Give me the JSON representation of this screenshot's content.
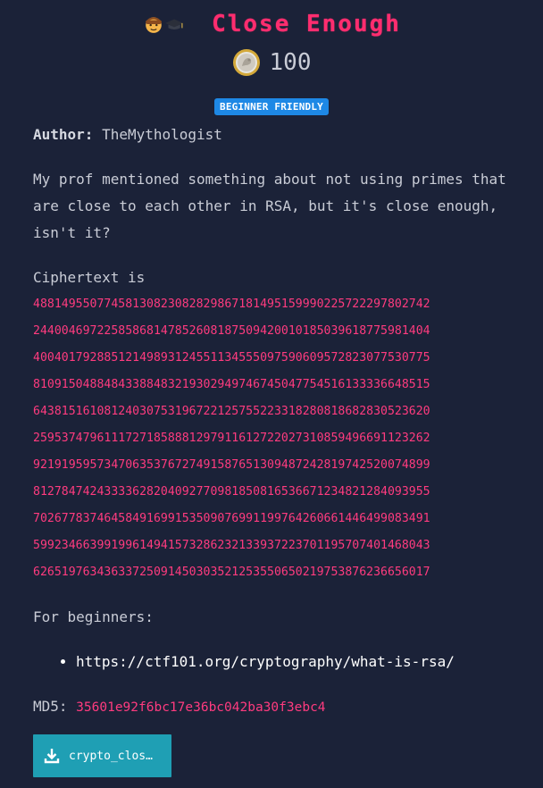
{
  "challenge": {
    "title": "Close Enough",
    "points": "100",
    "badge": "BEGINNER FRIENDLY",
    "author_label": "Author:",
    "author": "TheMythologist",
    "description": "My prof mentioned something about not using primes that are close to each other in RSA, but it's close enough, isn't it?",
    "ciphertext_label": "Ciphertext is",
    "ciphertext_lines": [
      "48814955077458130823082829867181495159990225722297802742",
      "24400469722585868147852608187509420010185039618775981404",
      "40040179288512149893124551134555097590609572823077530775",
      "81091504884843388483219302949746745047754516133336648515",
      "64381516108124030753196722125755223318280818682830523620",
      "25953747961117271858881297911612722027310859496691123262",
      "92191959573470635376727491587651309487242819742520074899",
      "81278474243333628204092770981850816536671234821284093955",
      "70267783746458491699153509076991199764260661446499083491",
      "59923466399199614941573286232133937223701195707401468043",
      "62651976343633725091450303521253550650219753876236656017"
    ],
    "beginners_label": "For beginners:",
    "links": [
      "https://ctf101.org/cryptography/what-is-rsa/"
    ],
    "md5_label": "MD5:",
    "md5": "35601e92f6bc17e36bc042ba30f3ebc4",
    "download_label": "crypto_clos…",
    "title_color": "#ff2d6f",
    "accent_pink": "#ff3b7f",
    "badge_color": "#1e88e5",
    "button_color": "#1f9fb4",
    "icons": [
      "student-emoji-icon",
      "coin-icon",
      "download-icon"
    ]
  }
}
